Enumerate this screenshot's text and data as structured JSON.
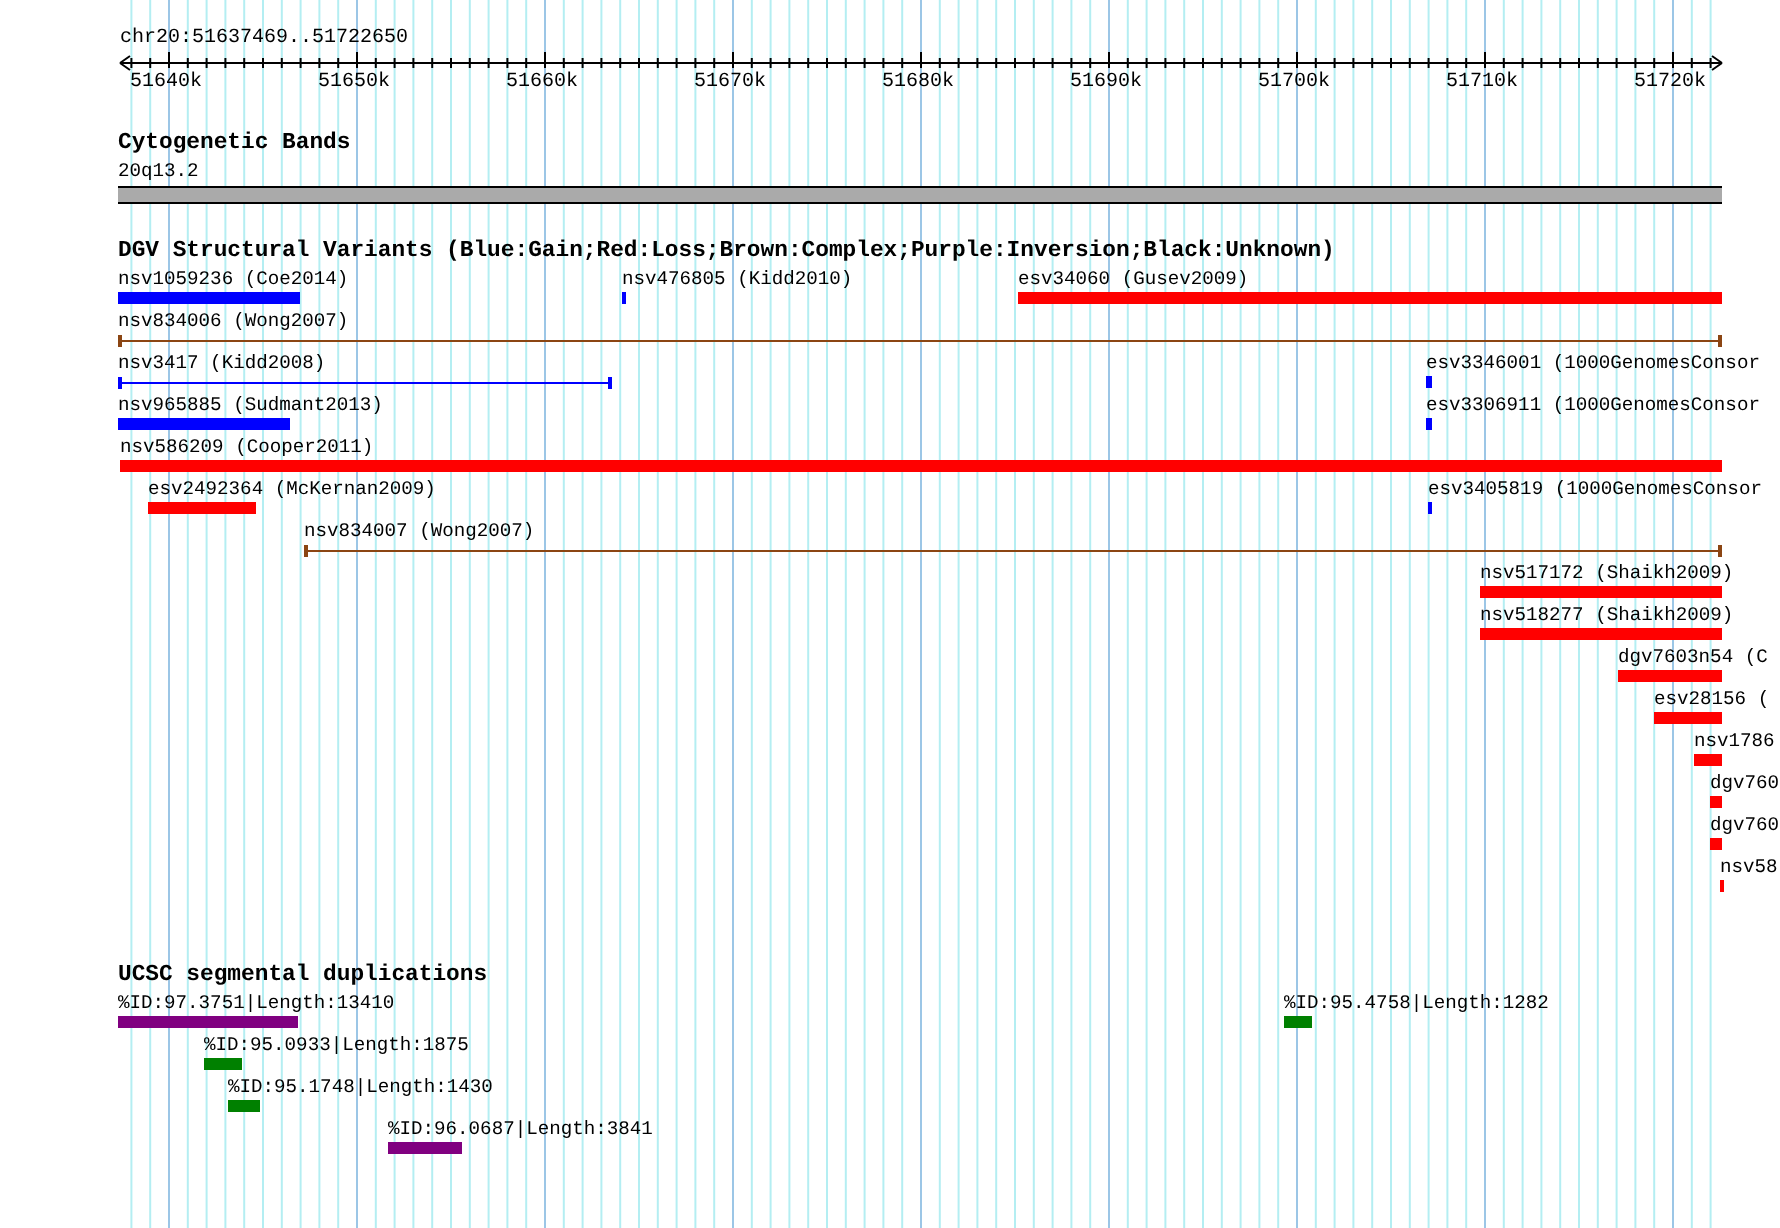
{
  "ruler": {
    "region": "chr20:51637469..51722650",
    "tick_labels": [
      "51640k",
      "51650k",
      "51660k",
      "51670k",
      "51680k",
      "51690k",
      "51700k",
      "51710k",
      "51720k"
    ]
  },
  "tracks": [
    {
      "title": "Cytogenetic Bands",
      "kind": "bands",
      "features": [
        {
          "label": "20q13.2",
          "kind": "band",
          "color": "#aaaaaa"
        }
      ]
    },
    {
      "title": "DGV Structural Variants (Blue:Gain;Red:Loss;Brown:Complex;Purple:Inversion;Black:Unknown)",
      "kind": "variants",
      "features": [
        {
          "label": "nsv1059236 (Coe2014)",
          "kind": "bar",
          "color": "#0000ff"
        },
        {
          "label": "nsv476805 (Kidd2010)",
          "kind": "bar",
          "color": "#0000ff"
        },
        {
          "label": "esv34060 (Gusev2009)",
          "kind": "bar",
          "color": "#ff0000"
        },
        {
          "label": "nsv834006 (Wong2007)",
          "kind": "line",
          "color": "#8b4513"
        },
        {
          "label": "nsv3417 (Kidd2008)",
          "kind": "line",
          "color": "#0000ff"
        },
        {
          "label": "esv3346001 (1000GenomesConsor",
          "kind": "bar",
          "color": "#0000ff"
        },
        {
          "label": "nsv965885 (Sudmant2013)",
          "kind": "bar",
          "color": "#0000ff"
        },
        {
          "label": "esv3306911 (1000GenomesConsor",
          "kind": "bar",
          "color": "#0000ff"
        },
        {
          "label": "nsv586209 (Cooper2011)",
          "kind": "bar",
          "color": "#ff0000"
        },
        {
          "label": "esv2492364 (McKernan2009)",
          "kind": "bar",
          "color": "#ff0000"
        },
        {
          "label": "esv3405819 (1000GenomesConsor",
          "kind": "bar",
          "color": "#0000ff"
        },
        {
          "label": "nsv834007 (Wong2007)",
          "kind": "line",
          "color": "#8b4513"
        },
        {
          "label": "nsv517172 (Shaikh2009)",
          "kind": "bar",
          "color": "#ff0000"
        },
        {
          "label": "nsv518277 (Shaikh2009)",
          "kind": "bar",
          "color": "#ff0000"
        },
        {
          "label": "dgv7603n54 (C",
          "kind": "bar",
          "color": "#ff0000"
        },
        {
          "label": "esv28156 (",
          "kind": "bar",
          "color": "#ff0000"
        },
        {
          "label": "nsv1786",
          "kind": "bar",
          "color": "#ff0000"
        },
        {
          "label": "dgv760",
          "kind": "bar",
          "color": "#ff0000"
        },
        {
          "label": "dgv760",
          "kind": "bar",
          "color": "#ff0000"
        },
        {
          "label": "nsv58",
          "kind": "bar",
          "color": "#ff0000"
        }
      ]
    },
    {
      "title": "UCSC segmental duplications",
      "kind": "duplications",
      "features": [
        {
          "label": "%ID:97.3751|Length:13410",
          "kind": "bar",
          "color": "#800080"
        },
        {
          "label": "%ID:95.4758|Length:1282",
          "kind": "bar",
          "color": "#008000"
        },
        {
          "label": "%ID:95.0933|Length:1875",
          "kind": "bar",
          "color": "#008000"
        },
        {
          "label": "%ID:95.1748|Length:1430",
          "kind": "bar",
          "color": "#008000"
        },
        {
          "label": "%ID:96.0687|Length:3841",
          "kind": "bar",
          "color": "#800080"
        }
      ]
    }
  ]
}
